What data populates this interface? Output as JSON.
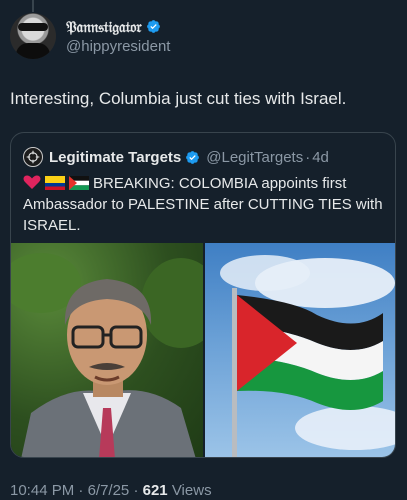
{
  "post": {
    "author_name": "𝔓𝔞𝔫𝔫𝔰𝔱𝔦𝔤𝔞𝔱𝔬𝔯",
    "author_handle": "@hippyresident",
    "text": "Interesting, Columbia just cut ties with Israel."
  },
  "quoted": {
    "name": "Legitimate Targets",
    "handle": "@LegitTargets",
    "separator": "·",
    "age": "4d",
    "text": "BREAKING: COLOMBIA appoints first Ambassador to PALESTINE after CUTTING TIES with ISRAEL.",
    "emoji_icons": [
      "red-heart",
      "colombia-flag",
      "palestine-flag"
    ]
  },
  "footer": {
    "time": "10:44 PM",
    "dot1": "·",
    "date": "6/7/25",
    "dot2": "·",
    "views_count": "621",
    "views_label": "Views"
  },
  "colors": {
    "background": "#15202b",
    "verified": "#1d9bf0",
    "muted": "#8b98a5",
    "text": "#e7e9ea"
  }
}
